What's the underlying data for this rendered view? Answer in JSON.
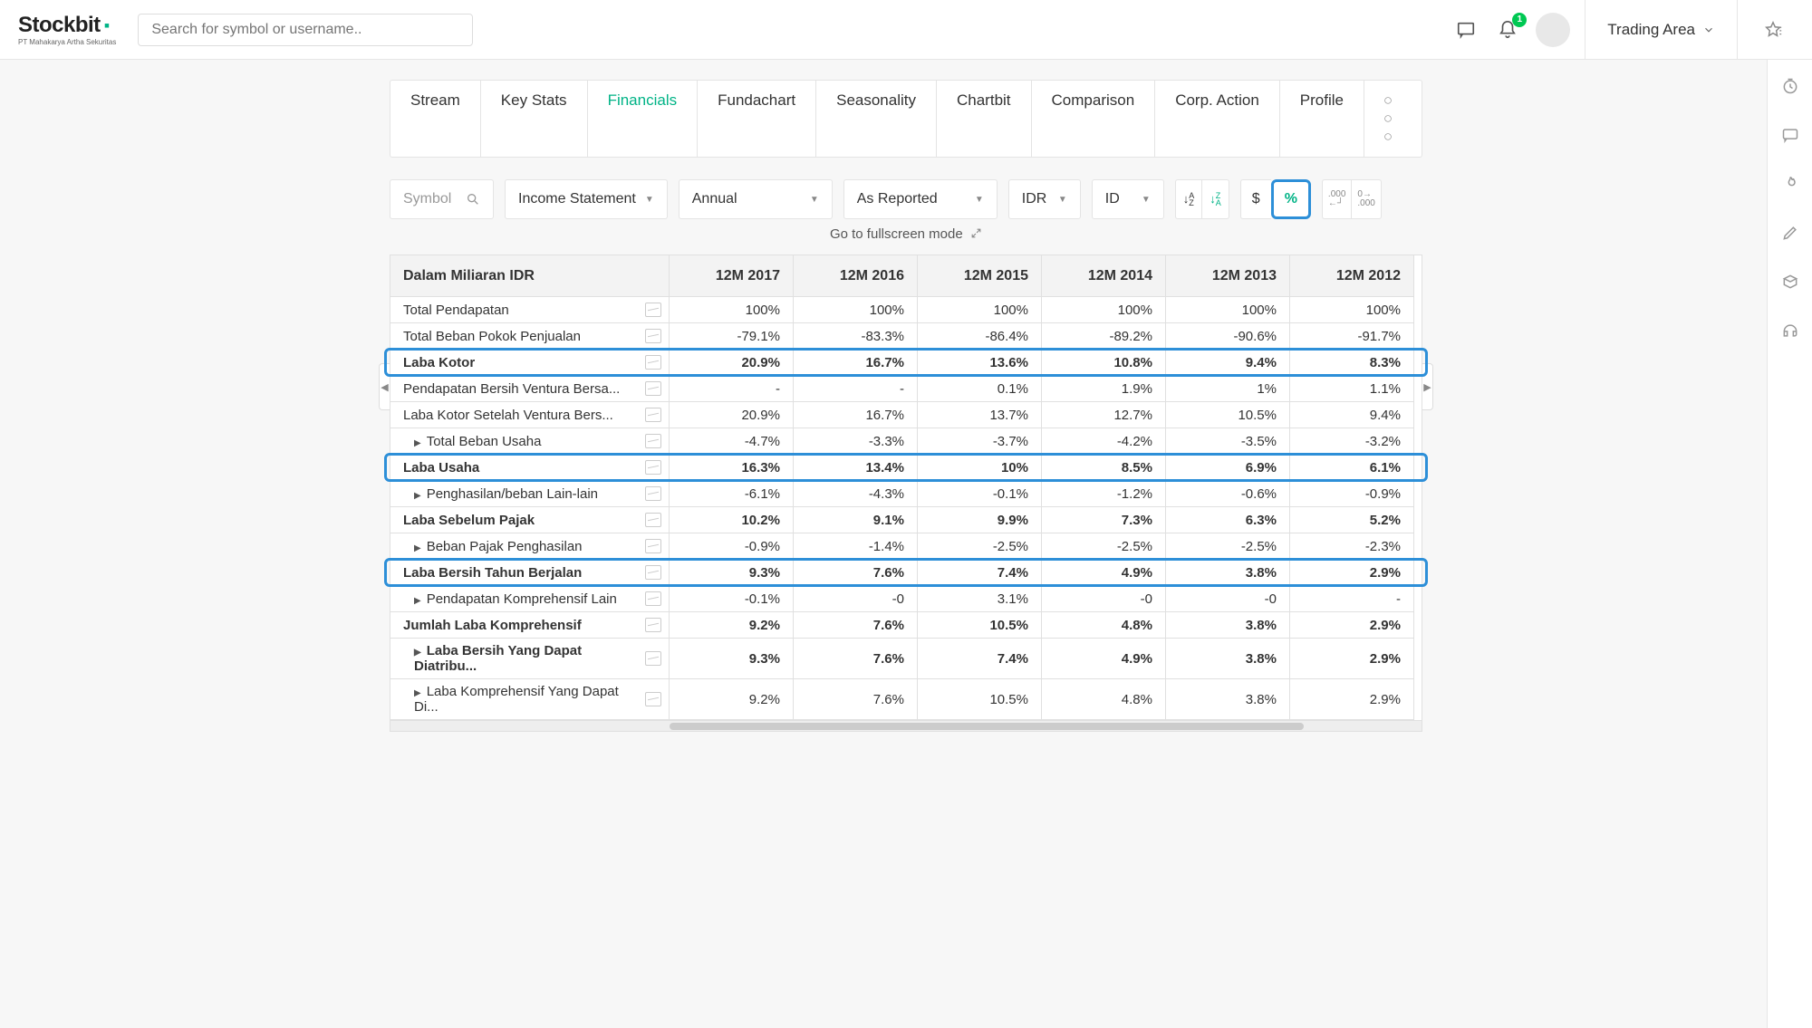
{
  "brand": {
    "name": "Stockbit",
    "tagline": "PT Mahakarya Artha Sekuritas"
  },
  "search": {
    "placeholder": "Search for symbol or username.."
  },
  "topbar": {
    "trading_area": "Trading Area",
    "notification_count": "1"
  },
  "tabs": [
    "Stream",
    "Key Stats",
    "Financials",
    "Fundachart",
    "Seasonality",
    "Chartbit",
    "Comparison",
    "Corp. Action",
    "Profile"
  ],
  "active_tab_index": 2,
  "toolbar": {
    "symbol_placeholder": "Symbol",
    "statement": "Income Statement",
    "period": "Annual",
    "view": "As Reported",
    "currency": "IDR",
    "lang": "ID",
    "dollar": "$",
    "pct": "%",
    "fmt_inc": ".000",
    "fmt_dec": ".000"
  },
  "fullscreen_label": "Go to fullscreen mode",
  "table": {
    "header_label": "Dalam Miliaran IDR",
    "columns": [
      "12M 2017",
      "12M 2016",
      "12M 2015",
      "12M 2014",
      "12M 2013",
      "12M 2012"
    ],
    "rows": [
      {
        "label": "Total Pendapatan",
        "bold": false,
        "expand": false,
        "highlight": false,
        "values": [
          "100%",
          "100%",
          "100%",
          "100%",
          "100%",
          "100%"
        ]
      },
      {
        "label": "Total Beban Pokok Penjualan",
        "bold": false,
        "expand": false,
        "highlight": false,
        "values": [
          "-79.1%",
          "-83.3%",
          "-86.4%",
          "-89.2%",
          "-90.6%",
          "-91.7%"
        ]
      },
      {
        "label": "Laba Kotor",
        "bold": true,
        "expand": false,
        "highlight": true,
        "values": [
          "20.9%",
          "16.7%",
          "13.6%",
          "10.8%",
          "9.4%",
          "8.3%"
        ]
      },
      {
        "label": "Pendapatan Bersih Ventura Bersa...",
        "bold": false,
        "expand": false,
        "highlight": false,
        "values": [
          "-",
          "-",
          "0.1%",
          "1.9%",
          "1%",
          "1.1%"
        ]
      },
      {
        "label": "Laba Kotor Setelah Ventura Bers...",
        "bold": false,
        "expand": false,
        "highlight": false,
        "values": [
          "20.9%",
          "16.7%",
          "13.7%",
          "12.7%",
          "10.5%",
          "9.4%"
        ]
      },
      {
        "label": "Total Beban Usaha",
        "bold": false,
        "expand": true,
        "highlight": false,
        "values": [
          "-4.7%",
          "-3.3%",
          "-3.7%",
          "-4.2%",
          "-3.5%",
          "-3.2%"
        ]
      },
      {
        "label": "Laba Usaha",
        "bold": true,
        "expand": false,
        "highlight": true,
        "values": [
          "16.3%",
          "13.4%",
          "10%",
          "8.5%",
          "6.9%",
          "6.1%"
        ]
      },
      {
        "label": "Penghasilan/beban Lain-lain",
        "bold": false,
        "expand": true,
        "highlight": false,
        "values": [
          "-6.1%",
          "-4.3%",
          "-0.1%",
          "-1.2%",
          "-0.6%",
          "-0.9%"
        ]
      },
      {
        "label": "Laba Sebelum Pajak",
        "bold": true,
        "expand": false,
        "highlight": false,
        "values": [
          "10.2%",
          "9.1%",
          "9.9%",
          "7.3%",
          "6.3%",
          "5.2%"
        ]
      },
      {
        "label": "Beban Pajak Penghasilan",
        "bold": false,
        "expand": true,
        "highlight": false,
        "values": [
          "-0.9%",
          "-1.4%",
          "-2.5%",
          "-2.5%",
          "-2.5%",
          "-2.3%"
        ]
      },
      {
        "label": "Laba Bersih Tahun Berjalan",
        "bold": true,
        "expand": false,
        "highlight": true,
        "values": [
          "9.3%",
          "7.6%",
          "7.4%",
          "4.9%",
          "3.8%",
          "2.9%"
        ]
      },
      {
        "label": "Pendapatan Komprehensif Lain",
        "bold": false,
        "expand": true,
        "highlight": false,
        "values": [
          "-0.1%",
          "-0",
          "3.1%",
          "-0",
          "-0",
          "-"
        ]
      },
      {
        "label": "Jumlah Laba Komprehensif",
        "bold": true,
        "expand": false,
        "highlight": false,
        "values": [
          "9.2%",
          "7.6%",
          "10.5%",
          "4.8%",
          "3.8%",
          "2.9%"
        ]
      },
      {
        "label": "Laba Bersih Yang Dapat Diatribu...",
        "bold": true,
        "expand": true,
        "highlight": false,
        "values": [
          "9.3%",
          "7.6%",
          "7.4%",
          "4.9%",
          "3.8%",
          "2.9%"
        ]
      },
      {
        "label": "Laba Komprehensif Yang Dapat Di...",
        "bold": false,
        "expand": true,
        "highlight": false,
        "values": [
          "9.2%",
          "7.6%",
          "10.5%",
          "4.8%",
          "3.8%",
          "2.9%"
        ]
      }
    ]
  }
}
